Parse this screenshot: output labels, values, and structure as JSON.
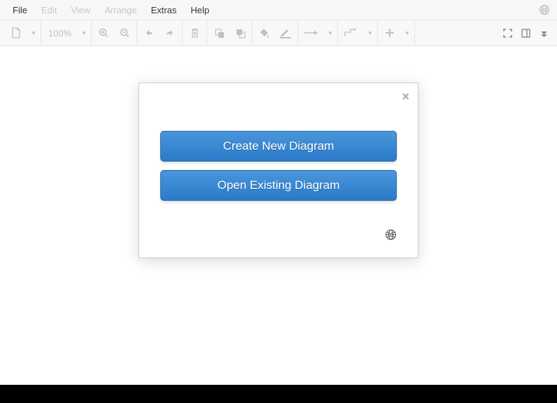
{
  "menubar": {
    "items": [
      {
        "label": "File",
        "active": true
      },
      {
        "label": "Edit",
        "active": false
      },
      {
        "label": "View",
        "active": false
      },
      {
        "label": "Arrange",
        "active": false
      },
      {
        "label": "Extras",
        "active": true
      },
      {
        "label": "Help",
        "active": true
      }
    ]
  },
  "toolbar": {
    "zoom_level": "100%"
  },
  "modal": {
    "create_label": "Create New Diagram",
    "open_label": "Open Existing Diagram"
  }
}
